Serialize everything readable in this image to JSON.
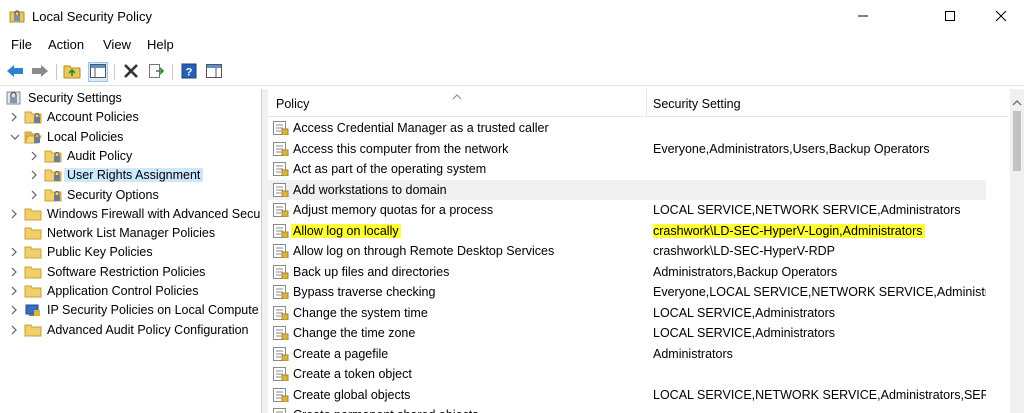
{
  "window": {
    "title": "Local Security Policy"
  },
  "menu": [
    "File",
    "Action",
    "View",
    "Help"
  ],
  "tree": [
    {
      "label": "Security Settings",
      "level": 0,
      "chevron": "none",
      "icon": "security-settings-icon"
    },
    {
      "label": "Account Policies",
      "level": 1,
      "chevron": "right",
      "icon": "folder-lock-icon"
    },
    {
      "label": "Local Policies",
      "level": 1,
      "chevron": "down",
      "icon": "folder-open-lock-icon"
    },
    {
      "label": "Audit Policy",
      "level": 2,
      "chevron": "right",
      "icon": "folder-lock-icon"
    },
    {
      "label": "User Rights Assignment",
      "level": 2,
      "chevron": "right",
      "icon": "folder-lock-icon",
      "selected": true
    },
    {
      "label": "Security Options",
      "level": 2,
      "chevron": "right",
      "icon": "folder-lock-icon"
    },
    {
      "label": "Windows Firewall with Advanced Secu",
      "level": 1,
      "chevron": "right",
      "icon": "folder-icon"
    },
    {
      "label": "Network List Manager Policies",
      "level": 1,
      "chevron": "none",
      "icon": "folder-icon"
    },
    {
      "label": "Public Key Policies",
      "level": 1,
      "chevron": "right",
      "icon": "folder-icon"
    },
    {
      "label": "Software Restriction Policies",
      "level": 1,
      "chevron": "right",
      "icon": "folder-icon"
    },
    {
      "label": "Application Control Policies",
      "level": 1,
      "chevron": "right",
      "icon": "folder-icon"
    },
    {
      "label": "IP Security Policies on Local Compute",
      "level": 1,
      "chevron": "right",
      "icon": "ip-security-icon"
    },
    {
      "label": "Advanced Audit Policy Configuration",
      "level": 1,
      "chevron": "right",
      "icon": "folder-icon"
    }
  ],
  "columns": {
    "policy": "Policy",
    "setting": "Security Setting"
  },
  "policies": [
    {
      "name": "Access Credential Manager as a trusted caller",
      "setting": ""
    },
    {
      "name": "Access this computer from the network",
      "setting": "Everyone,Administrators,Users,Backup Operators"
    },
    {
      "name": "Act as part of the operating system",
      "setting": ""
    },
    {
      "name": "Add workstations to domain",
      "setting": "",
      "hover": true
    },
    {
      "name": "Adjust memory quotas for a process",
      "setting": "LOCAL SERVICE,NETWORK SERVICE,Administrators"
    },
    {
      "name": "Allow log on locally",
      "setting": "crashwork\\LD-SEC-HyperV-Login,Administrators",
      "highlight": true
    },
    {
      "name": "Allow log on through Remote Desktop Services",
      "setting": "crashwork\\LD-SEC-HyperV-RDP"
    },
    {
      "name": "Back up files and directories",
      "setting": "Administrators,Backup Operators"
    },
    {
      "name": "Bypass traverse checking",
      "setting": "Everyone,LOCAL SERVICE,NETWORK SERVICE,Administr..."
    },
    {
      "name": "Change the system time",
      "setting": "LOCAL SERVICE,Administrators"
    },
    {
      "name": "Change the time zone",
      "setting": "LOCAL SERVICE,Administrators"
    },
    {
      "name": "Create a pagefile",
      "setting": "Administrators"
    },
    {
      "name": "Create a token object",
      "setting": ""
    },
    {
      "name": "Create global objects",
      "setting": "LOCAL SERVICE,NETWORK SERVICE,Administrators,SER..."
    },
    {
      "name": "Create permanent shared objects",
      "setting": ""
    }
  ],
  "colors": {
    "selection": "#cce8ff",
    "highlight": "#ffff33",
    "hover": "#f0f0f0"
  }
}
